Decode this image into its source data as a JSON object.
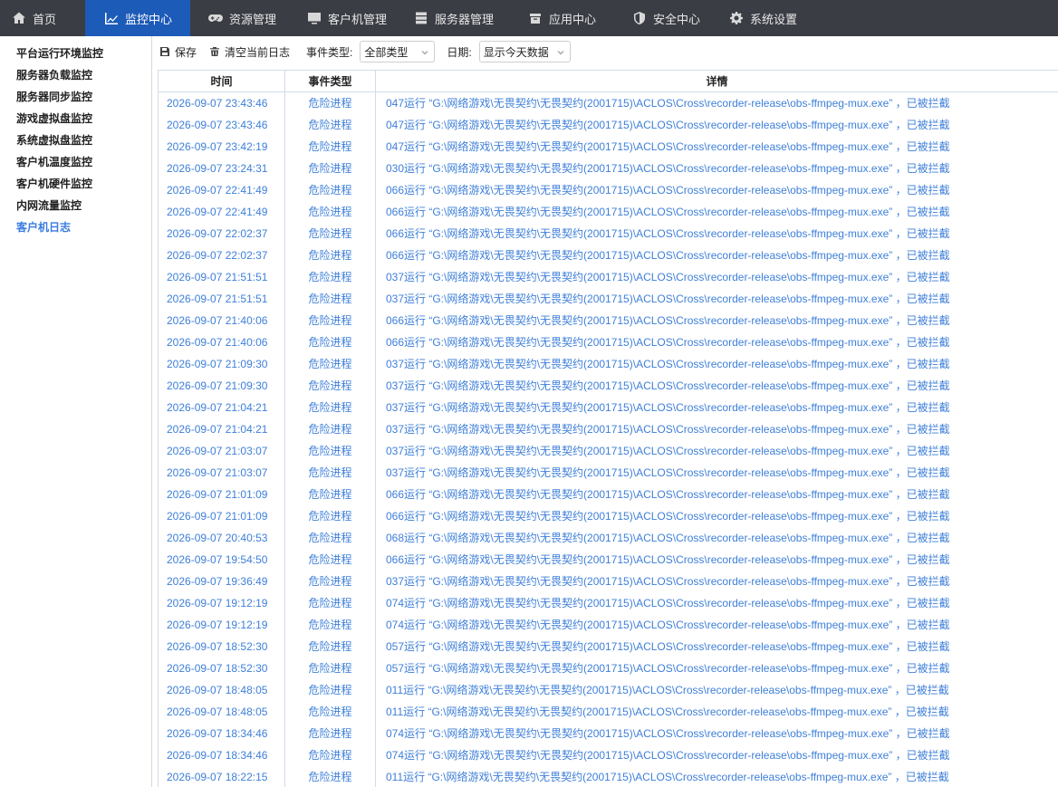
{
  "nav": [
    {
      "label": "首页",
      "icon": "home-icon",
      "active": false
    },
    {
      "label": "监控中心",
      "icon": "chart-icon",
      "active": true
    },
    {
      "label": "资源管理",
      "icon": "gamepad-icon",
      "active": false
    },
    {
      "label": "客户机管理",
      "icon": "monitor-icon",
      "active": false
    },
    {
      "label": "服务器管理",
      "icon": "server-icon",
      "active": false
    },
    {
      "label": "应用中心",
      "icon": "box-icon",
      "active": false
    },
    {
      "label": "安全中心",
      "icon": "shield-icon",
      "active": false
    },
    {
      "label": "系统设置",
      "icon": "gear-icon",
      "active": false
    }
  ],
  "sidebar": [
    {
      "label": "平台运行环境监控",
      "active": false
    },
    {
      "label": "服务器负载监控",
      "active": false
    },
    {
      "label": "服务器同步监控",
      "active": false
    },
    {
      "label": "游戏虚拟盘监控",
      "active": false
    },
    {
      "label": "系统虚拟盘监控",
      "active": false
    },
    {
      "label": "客户机温度监控",
      "active": false
    },
    {
      "label": "客户机硬件监控",
      "active": false
    },
    {
      "label": "内网流量监控",
      "active": false
    },
    {
      "label": "客户机日志",
      "active": true
    }
  ],
  "toolbar": {
    "save_label": "保存",
    "clear_label": "清空当前日志",
    "event_type_label": "事件类型:",
    "event_type_value": "全部类型",
    "date_label": "日期:",
    "date_value": "显示今天数据"
  },
  "table": {
    "headers": [
      "时间",
      "事件类型",
      "详情"
    ],
    "rows": [
      [
        "2026-09-07 23:43:46",
        "危险进程",
        "047运行 “G:\\网络游戏\\无畏契约\\无畏契约(2001715)\\ACLOS\\Cross\\recorder-release\\obs-ffmpeg-mux.exe” ，已被拦截"
      ],
      [
        "2026-09-07 23:43:46",
        "危险进程",
        "047运行 “G:\\网络游戏\\无畏契约\\无畏契约(2001715)\\ACLOS\\Cross\\recorder-release\\obs-ffmpeg-mux.exe” ，已被拦截"
      ],
      [
        "2026-09-07 23:42:19",
        "危险进程",
        "047运行 “G:\\网络游戏\\无畏契约\\无畏契约(2001715)\\ACLOS\\Cross\\recorder-release\\obs-ffmpeg-mux.exe” ，已被拦截"
      ],
      [
        "2026-09-07 23:24:31",
        "危险进程",
        "030运行 “G:\\网络游戏\\无畏契约\\无畏契约(2001715)\\ACLOS\\Cross\\recorder-release\\obs-ffmpeg-mux.exe” ，已被拦截"
      ],
      [
        "2026-09-07 22:41:49",
        "危险进程",
        "066运行 “G:\\网络游戏\\无畏契约\\无畏契约(2001715)\\ACLOS\\Cross\\recorder-release\\obs-ffmpeg-mux.exe” ，已被拦截"
      ],
      [
        "2026-09-07 22:41:49",
        "危险进程",
        "066运行 “G:\\网络游戏\\无畏契约\\无畏契约(2001715)\\ACLOS\\Cross\\recorder-release\\obs-ffmpeg-mux.exe” ，已被拦截"
      ],
      [
        "2026-09-07 22:02:37",
        "危险进程",
        "066运行 “G:\\网络游戏\\无畏契约\\无畏契约(2001715)\\ACLOS\\Cross\\recorder-release\\obs-ffmpeg-mux.exe” ，已被拦截"
      ],
      [
        "2026-09-07 22:02:37",
        "危险进程",
        "066运行 “G:\\网络游戏\\无畏契约\\无畏契约(2001715)\\ACLOS\\Cross\\recorder-release\\obs-ffmpeg-mux.exe” ，已被拦截"
      ],
      [
        "2026-09-07 21:51:51",
        "危险进程",
        "037运行 “G:\\网络游戏\\无畏契约\\无畏契约(2001715)\\ACLOS\\Cross\\recorder-release\\obs-ffmpeg-mux.exe” ，已被拦截"
      ],
      [
        "2026-09-07 21:51:51",
        "危险进程",
        "037运行 “G:\\网络游戏\\无畏契约\\无畏契约(2001715)\\ACLOS\\Cross\\recorder-release\\obs-ffmpeg-mux.exe” ，已被拦截"
      ],
      [
        "2026-09-07 21:40:06",
        "危险进程",
        "066运行 “G:\\网络游戏\\无畏契约\\无畏契约(2001715)\\ACLOS\\Cross\\recorder-release\\obs-ffmpeg-mux.exe” ，已被拦截"
      ],
      [
        "2026-09-07 21:40:06",
        "危险进程",
        "066运行 “G:\\网络游戏\\无畏契约\\无畏契约(2001715)\\ACLOS\\Cross\\recorder-release\\obs-ffmpeg-mux.exe” ，已被拦截"
      ],
      [
        "2026-09-07 21:09:30",
        "危险进程",
        "037运行 “G:\\网络游戏\\无畏契约\\无畏契约(2001715)\\ACLOS\\Cross\\recorder-release\\obs-ffmpeg-mux.exe” ，已被拦截"
      ],
      [
        "2026-09-07 21:09:30",
        "危险进程",
        "037运行 “G:\\网络游戏\\无畏契约\\无畏契约(2001715)\\ACLOS\\Cross\\recorder-release\\obs-ffmpeg-mux.exe” ，已被拦截"
      ],
      [
        "2026-09-07 21:04:21",
        "危险进程",
        "037运行 “G:\\网络游戏\\无畏契约\\无畏契约(2001715)\\ACLOS\\Cross\\recorder-release\\obs-ffmpeg-mux.exe” ，已被拦截"
      ],
      [
        "2026-09-07 21:04:21",
        "危险进程",
        "037运行 “G:\\网络游戏\\无畏契约\\无畏契约(2001715)\\ACLOS\\Cross\\recorder-release\\obs-ffmpeg-mux.exe” ，已被拦截"
      ],
      [
        "2026-09-07 21:03:07",
        "危险进程",
        "037运行 “G:\\网络游戏\\无畏契约\\无畏契约(2001715)\\ACLOS\\Cross\\recorder-release\\obs-ffmpeg-mux.exe” ，已被拦截"
      ],
      [
        "2026-09-07 21:03:07",
        "危险进程",
        "037运行 “G:\\网络游戏\\无畏契约\\无畏契约(2001715)\\ACLOS\\Cross\\recorder-release\\obs-ffmpeg-mux.exe” ，已被拦截"
      ],
      [
        "2026-09-07 21:01:09",
        "危险进程",
        "066运行 “G:\\网络游戏\\无畏契约\\无畏契约(2001715)\\ACLOS\\Cross\\recorder-release\\obs-ffmpeg-mux.exe” ，已被拦截"
      ],
      [
        "2026-09-07 21:01:09",
        "危险进程",
        "066运行 “G:\\网络游戏\\无畏契约\\无畏契约(2001715)\\ACLOS\\Cross\\recorder-release\\obs-ffmpeg-mux.exe” ，已被拦截"
      ],
      [
        "2026-09-07 20:40:53",
        "危险进程",
        "068运行 “G:\\网络游戏\\无畏契约\\无畏契约(2001715)\\ACLOS\\Cross\\recorder-release\\obs-ffmpeg-mux.exe” ，已被拦截"
      ],
      [
        "2026-09-07 19:54:50",
        "危险进程",
        "066运行 “G:\\网络游戏\\无畏契约\\无畏契约(2001715)\\ACLOS\\Cross\\recorder-release\\obs-ffmpeg-mux.exe” ，已被拦截"
      ],
      [
        "2026-09-07 19:36:49",
        "危险进程",
        "037运行 “G:\\网络游戏\\无畏契约\\无畏契约(2001715)\\ACLOS\\Cross\\recorder-release\\obs-ffmpeg-mux.exe” ，已被拦截"
      ],
      [
        "2026-09-07 19:12:19",
        "危险进程",
        "074运行 “G:\\网络游戏\\无畏契约\\无畏契约(2001715)\\ACLOS\\Cross\\recorder-release\\obs-ffmpeg-mux.exe” ，已被拦截"
      ],
      [
        "2026-09-07 19:12:19",
        "危险进程",
        "074运行 “G:\\网络游戏\\无畏契约\\无畏契约(2001715)\\ACLOS\\Cross\\recorder-release\\obs-ffmpeg-mux.exe” ，已被拦截"
      ],
      [
        "2026-09-07 18:52:30",
        "危险进程",
        "057运行 “G:\\网络游戏\\无畏契约\\无畏契约(2001715)\\ACLOS\\Cross\\recorder-release\\obs-ffmpeg-mux.exe” ，已被拦截"
      ],
      [
        "2026-09-07 18:52:30",
        "危险进程",
        "057运行 “G:\\网络游戏\\无畏契约\\无畏契约(2001715)\\ACLOS\\Cross\\recorder-release\\obs-ffmpeg-mux.exe” ，已被拦截"
      ],
      [
        "2026-09-07 18:48:05",
        "危险进程",
        "011运行 “G:\\网络游戏\\无畏契约\\无畏契约(2001715)\\ACLOS\\Cross\\recorder-release\\obs-ffmpeg-mux.exe” ，已被拦截"
      ],
      [
        "2026-09-07 18:48:05",
        "危险进程",
        "011运行 “G:\\网络游戏\\无畏契约\\无畏契约(2001715)\\ACLOS\\Cross\\recorder-release\\obs-ffmpeg-mux.exe” ，已被拦截"
      ],
      [
        "2026-09-07 18:34:46",
        "危险进程",
        "074运行 “G:\\网络游戏\\无畏契约\\无畏契约(2001715)\\ACLOS\\Cross\\recorder-release\\obs-ffmpeg-mux.exe” ，已被拦截"
      ],
      [
        "2026-09-07 18:34:46",
        "危险进程",
        "074运行 “G:\\网络游戏\\无畏契约\\无畏契约(2001715)\\ACLOS\\Cross\\recorder-release\\obs-ffmpeg-mux.exe” ，已被拦截"
      ],
      [
        "2026-09-07 18:22:15",
        "危险进程",
        "011运行 “G:\\网络游戏\\无畏契约\\无畏契约(2001715)\\ACLOS\\Cross\\recorder-release\\obs-ffmpeg-mux.exe” ，已被拦截"
      ]
    ]
  },
  "colors": {
    "nav_bg": "#3a3d44",
    "nav_active": "#1d5bb8",
    "link_blue": "#3e7fd9",
    "sidebar_active": "#3a7be0"
  }
}
